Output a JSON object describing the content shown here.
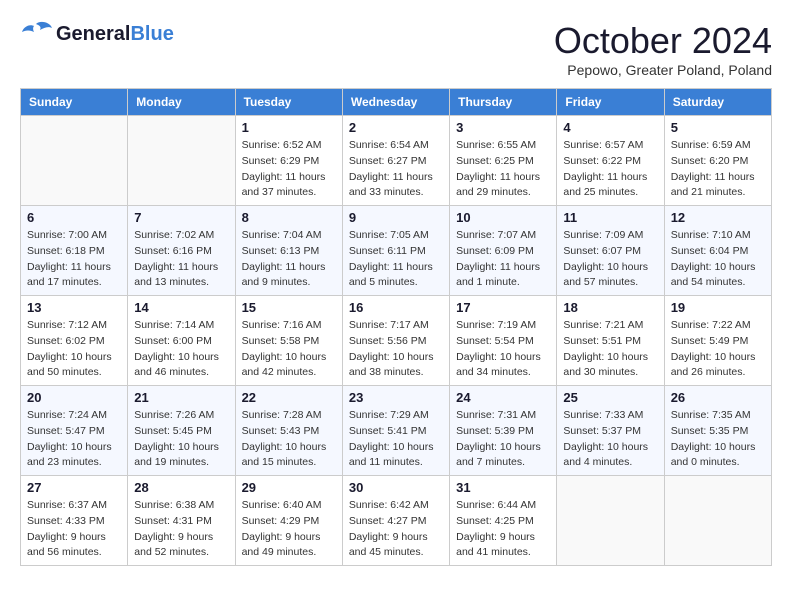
{
  "header": {
    "logo_general": "General",
    "logo_blue": "Blue",
    "month_title": "October 2024",
    "subtitle": "Pepowo, Greater Poland, Poland"
  },
  "days_of_week": [
    "Sunday",
    "Monday",
    "Tuesday",
    "Wednesday",
    "Thursday",
    "Friday",
    "Saturday"
  ],
  "weeks": [
    [
      {
        "day": "",
        "sunrise": "",
        "sunset": "",
        "daylight": ""
      },
      {
        "day": "",
        "sunrise": "",
        "sunset": "",
        "daylight": ""
      },
      {
        "day": "1",
        "sunrise": "Sunrise: 6:52 AM",
        "sunset": "Sunset: 6:29 PM",
        "daylight": "Daylight: 11 hours and 37 minutes."
      },
      {
        "day": "2",
        "sunrise": "Sunrise: 6:54 AM",
        "sunset": "Sunset: 6:27 PM",
        "daylight": "Daylight: 11 hours and 33 minutes."
      },
      {
        "day": "3",
        "sunrise": "Sunrise: 6:55 AM",
        "sunset": "Sunset: 6:25 PM",
        "daylight": "Daylight: 11 hours and 29 minutes."
      },
      {
        "day": "4",
        "sunrise": "Sunrise: 6:57 AM",
        "sunset": "Sunset: 6:22 PM",
        "daylight": "Daylight: 11 hours and 25 minutes."
      },
      {
        "day": "5",
        "sunrise": "Sunrise: 6:59 AM",
        "sunset": "Sunset: 6:20 PM",
        "daylight": "Daylight: 11 hours and 21 minutes."
      }
    ],
    [
      {
        "day": "6",
        "sunrise": "Sunrise: 7:00 AM",
        "sunset": "Sunset: 6:18 PM",
        "daylight": "Daylight: 11 hours and 17 minutes."
      },
      {
        "day": "7",
        "sunrise": "Sunrise: 7:02 AM",
        "sunset": "Sunset: 6:16 PM",
        "daylight": "Daylight: 11 hours and 13 minutes."
      },
      {
        "day": "8",
        "sunrise": "Sunrise: 7:04 AM",
        "sunset": "Sunset: 6:13 PM",
        "daylight": "Daylight: 11 hours and 9 minutes."
      },
      {
        "day": "9",
        "sunrise": "Sunrise: 7:05 AM",
        "sunset": "Sunset: 6:11 PM",
        "daylight": "Daylight: 11 hours and 5 minutes."
      },
      {
        "day": "10",
        "sunrise": "Sunrise: 7:07 AM",
        "sunset": "Sunset: 6:09 PM",
        "daylight": "Daylight: 11 hours and 1 minute."
      },
      {
        "day": "11",
        "sunrise": "Sunrise: 7:09 AM",
        "sunset": "Sunset: 6:07 PM",
        "daylight": "Daylight: 10 hours and 57 minutes."
      },
      {
        "day": "12",
        "sunrise": "Sunrise: 7:10 AM",
        "sunset": "Sunset: 6:04 PM",
        "daylight": "Daylight: 10 hours and 54 minutes."
      }
    ],
    [
      {
        "day": "13",
        "sunrise": "Sunrise: 7:12 AM",
        "sunset": "Sunset: 6:02 PM",
        "daylight": "Daylight: 10 hours and 50 minutes."
      },
      {
        "day": "14",
        "sunrise": "Sunrise: 7:14 AM",
        "sunset": "Sunset: 6:00 PM",
        "daylight": "Daylight: 10 hours and 46 minutes."
      },
      {
        "day": "15",
        "sunrise": "Sunrise: 7:16 AM",
        "sunset": "Sunset: 5:58 PM",
        "daylight": "Daylight: 10 hours and 42 minutes."
      },
      {
        "day": "16",
        "sunrise": "Sunrise: 7:17 AM",
        "sunset": "Sunset: 5:56 PM",
        "daylight": "Daylight: 10 hours and 38 minutes."
      },
      {
        "day": "17",
        "sunrise": "Sunrise: 7:19 AM",
        "sunset": "Sunset: 5:54 PM",
        "daylight": "Daylight: 10 hours and 34 minutes."
      },
      {
        "day": "18",
        "sunrise": "Sunrise: 7:21 AM",
        "sunset": "Sunset: 5:51 PM",
        "daylight": "Daylight: 10 hours and 30 minutes."
      },
      {
        "day": "19",
        "sunrise": "Sunrise: 7:22 AM",
        "sunset": "Sunset: 5:49 PM",
        "daylight": "Daylight: 10 hours and 26 minutes."
      }
    ],
    [
      {
        "day": "20",
        "sunrise": "Sunrise: 7:24 AM",
        "sunset": "Sunset: 5:47 PM",
        "daylight": "Daylight: 10 hours and 23 minutes."
      },
      {
        "day": "21",
        "sunrise": "Sunrise: 7:26 AM",
        "sunset": "Sunset: 5:45 PM",
        "daylight": "Daylight: 10 hours and 19 minutes."
      },
      {
        "day": "22",
        "sunrise": "Sunrise: 7:28 AM",
        "sunset": "Sunset: 5:43 PM",
        "daylight": "Daylight: 10 hours and 15 minutes."
      },
      {
        "day": "23",
        "sunrise": "Sunrise: 7:29 AM",
        "sunset": "Sunset: 5:41 PM",
        "daylight": "Daylight: 10 hours and 11 minutes."
      },
      {
        "day": "24",
        "sunrise": "Sunrise: 7:31 AM",
        "sunset": "Sunset: 5:39 PM",
        "daylight": "Daylight: 10 hours and 7 minutes."
      },
      {
        "day": "25",
        "sunrise": "Sunrise: 7:33 AM",
        "sunset": "Sunset: 5:37 PM",
        "daylight": "Daylight: 10 hours and 4 minutes."
      },
      {
        "day": "26",
        "sunrise": "Sunrise: 7:35 AM",
        "sunset": "Sunset: 5:35 PM",
        "daylight": "Daylight: 10 hours and 0 minutes."
      }
    ],
    [
      {
        "day": "27",
        "sunrise": "Sunrise: 6:37 AM",
        "sunset": "Sunset: 4:33 PM",
        "daylight": "Daylight: 9 hours and 56 minutes."
      },
      {
        "day": "28",
        "sunrise": "Sunrise: 6:38 AM",
        "sunset": "Sunset: 4:31 PM",
        "daylight": "Daylight: 9 hours and 52 minutes."
      },
      {
        "day": "29",
        "sunrise": "Sunrise: 6:40 AM",
        "sunset": "Sunset: 4:29 PM",
        "daylight": "Daylight: 9 hours and 49 minutes."
      },
      {
        "day": "30",
        "sunrise": "Sunrise: 6:42 AM",
        "sunset": "Sunset: 4:27 PM",
        "daylight": "Daylight: 9 hours and 45 minutes."
      },
      {
        "day": "31",
        "sunrise": "Sunrise: 6:44 AM",
        "sunset": "Sunset: 4:25 PM",
        "daylight": "Daylight: 9 hours and 41 minutes."
      },
      {
        "day": "",
        "sunrise": "",
        "sunset": "",
        "daylight": ""
      },
      {
        "day": "",
        "sunrise": "",
        "sunset": "",
        "daylight": ""
      }
    ]
  ]
}
